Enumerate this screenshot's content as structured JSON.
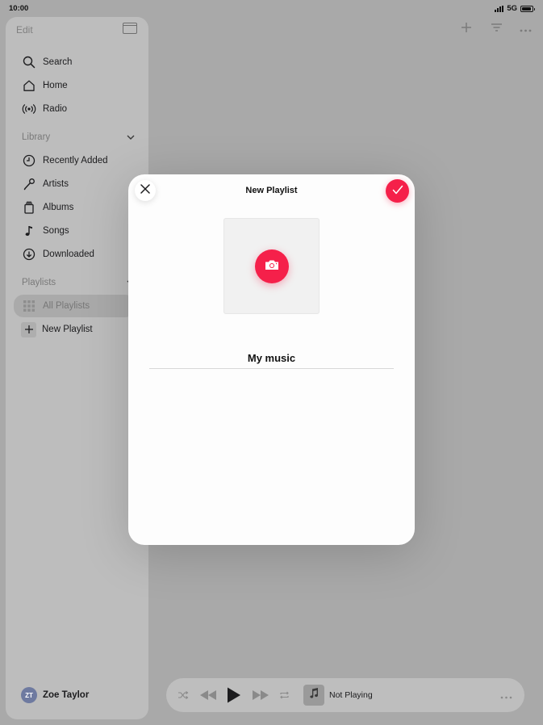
{
  "status_bar": {
    "time": "10:00",
    "network": "5G",
    "battery_percent": 90
  },
  "sidebar": {
    "edit_label": "Edit",
    "items": [
      {
        "label": "Search",
        "icon": "search-icon"
      },
      {
        "label": "Home",
        "icon": "home-icon"
      },
      {
        "label": "Radio",
        "icon": "radio-icon"
      }
    ],
    "library": {
      "header": "Library",
      "items": [
        {
          "label": "Recently Added",
          "icon": "clock-icon"
        },
        {
          "label": "Artists",
          "icon": "microphone-icon"
        },
        {
          "label": "Albums",
          "icon": "album-stack-icon"
        },
        {
          "label": "Songs",
          "icon": "music-note-icon"
        },
        {
          "label": "Downloaded",
          "icon": "download-icon"
        }
      ]
    },
    "playlists": {
      "header": "Playlists",
      "items": [
        {
          "label": "All Playlists",
          "icon": "grid-icon",
          "selected": true
        },
        {
          "label": "New Playlist",
          "icon": "plus-icon"
        }
      ]
    },
    "profile": {
      "initials": "ZT",
      "name": "Zoe Taylor"
    }
  },
  "player": {
    "now_playing": "Not Playing"
  },
  "modal": {
    "title": "New Playlist",
    "playlist_name_value": "My music",
    "accent": "#f5204a"
  }
}
